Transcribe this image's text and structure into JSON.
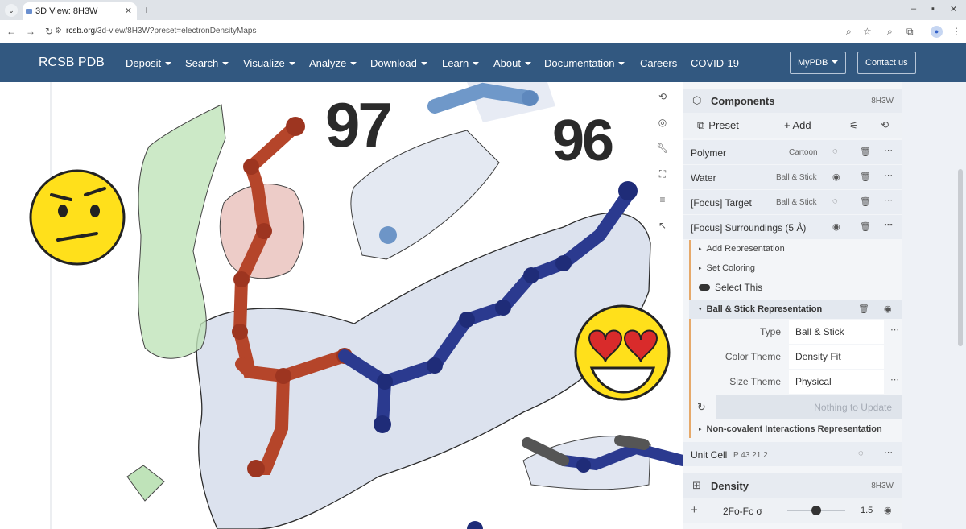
{
  "browser": {
    "tab_title": "3D View: 8H3W",
    "url_host": "rcsb.org",
    "url_path": "/3d-view/8H3W?preset=electronDensityMaps"
  },
  "site": {
    "brand": "RCSB PDB",
    "nav": [
      "Deposit",
      "Search",
      "Visualize",
      "Analyze",
      "Download",
      "Learn",
      "About",
      "Documentation",
      "Careers",
      "COVID-19"
    ],
    "mypdb": "MyPDB",
    "contact": "Contact us"
  },
  "viewer": {
    "label_left": "97",
    "label_right": "96"
  },
  "components": {
    "title": "Components",
    "entry_id": "8H3W",
    "preset_label": "Preset",
    "add_label": "+ Add",
    "items": [
      {
        "name": "Polymer",
        "repr": "Cartoon"
      },
      {
        "name": "Water",
        "repr": "Ball & Stick"
      },
      {
        "name": "[Focus] Target",
        "repr": "Ball & Stick"
      },
      {
        "name": "[Focus] Surroundings (5 Å)",
        "repr": ""
      }
    ],
    "add_representation": "Add Representation",
    "set_coloring": "Set Coloring",
    "select_this": "Select This",
    "representation": {
      "title": "Ball & Stick Representation",
      "props": [
        {
          "key": "Type",
          "value": "Ball & Stick"
        },
        {
          "key": "Color Theme",
          "value": "Density Fit"
        },
        {
          "key": "Size Theme",
          "value": "Physical"
        }
      ],
      "update_label": "Nothing to Update"
    },
    "noncovalent": "Non-covalent Interactions Representation",
    "unit_cell": "Unit Cell",
    "unit_cell_group": "P 43 21 2"
  },
  "density": {
    "title": "Density",
    "entry_id": "8H3W",
    "map_label": "2Fo-Fc σ",
    "sigma": "1.5",
    "sigma_fraction": 0.5
  },
  "colors": {
    "nav_bg": "#325880",
    "red_stick": "#b5452a",
    "blue_stick": "#2b3a8f",
    "density_mesh": "#b8c5dd"
  }
}
